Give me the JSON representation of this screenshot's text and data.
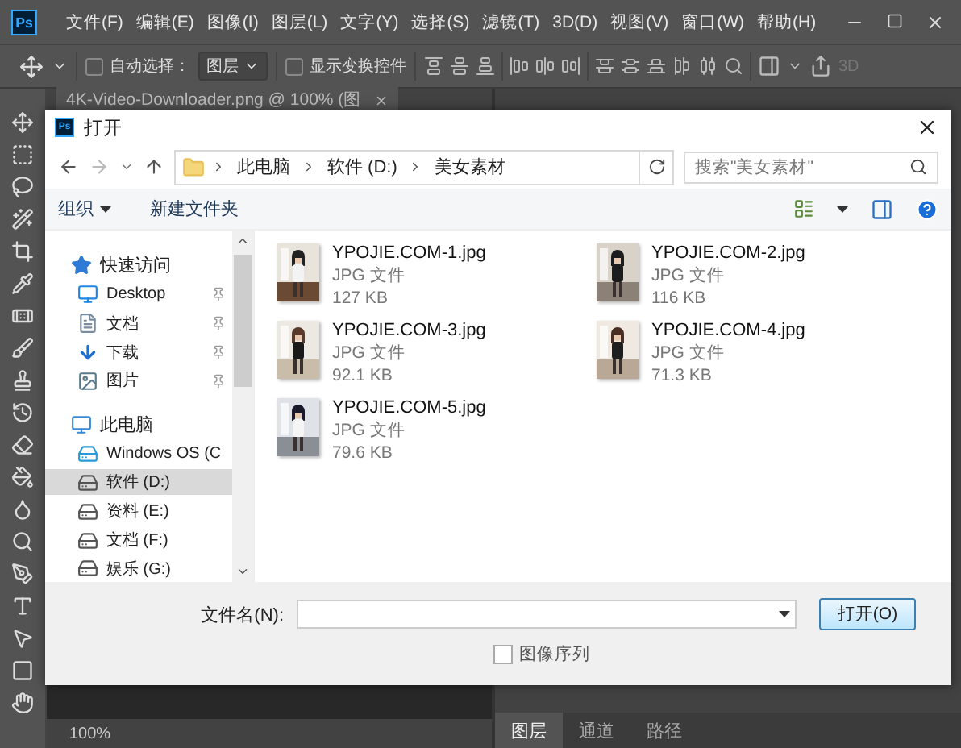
{
  "app": {
    "logo": "Ps",
    "menu": [
      "文件(F)",
      "编辑(E)",
      "图像(I)",
      "图层(L)",
      "文字(Y)",
      "选择(S)",
      "滤镜(T)",
      "3D(D)",
      "视图(V)",
      "窗口(W)",
      "帮助(H)"
    ]
  },
  "options_bar": {
    "auto_select": {
      "label": "自动选择：",
      "checked": false
    },
    "layer_select": "图层",
    "show_transform": {
      "label": "显示变换控件",
      "checked": false
    },
    "mode_3d": "3D"
  },
  "document_tab": {
    "title": "4K-Video-Downloader.png @ 100% (图"
  },
  "dialog": {
    "logo": "Ps",
    "title": "打开",
    "breadcrumb": [
      "此电脑",
      "软件 (D:)",
      "美女素材"
    ],
    "search": {
      "placeholder": "搜索\"美女素材\""
    },
    "commands": [
      "组织",
      "新建文件夹"
    ],
    "sidebar": [
      {
        "label": "快速访问",
        "kind": "quick-access",
        "selected": false,
        "children": [
          {
            "label": "Desktop",
            "kind": "desktop",
            "pinned": true,
            "selected": false
          },
          {
            "label": "文档",
            "kind": "documents",
            "pinned": true,
            "selected": false
          },
          {
            "label": "下载",
            "kind": "downloads",
            "pinned": true,
            "selected": false
          },
          {
            "label": "图片",
            "kind": "pictures",
            "pinned": true,
            "selected": false
          }
        ]
      },
      {
        "label": "此电脑",
        "kind": "computer",
        "selected": false,
        "children": [
          {
            "label": "Windows OS (C",
            "kind": "system-drive",
            "selected": false
          },
          {
            "label": "软件 (D:)",
            "kind": "drive",
            "selected": true
          },
          {
            "label": "资料 (E:)",
            "kind": "drive",
            "selected": false
          },
          {
            "label": "文档 (F:)",
            "kind": "drive",
            "selected": false
          },
          {
            "label": "娱乐 (G:)",
            "kind": "drive",
            "selected": false
          }
        ]
      }
    ],
    "files": [
      {
        "name": "YPOJIE.COM-1.jpg",
        "type": "JPG 文件",
        "size": "127 KB"
      },
      {
        "name": "YPOJIE.COM-2.jpg",
        "type": "JPG 文件",
        "size": "116 KB"
      },
      {
        "name": "YPOJIE.COM-3.jpg",
        "type": "JPG 文件",
        "size": "92.1 KB"
      },
      {
        "name": "YPOJIE.COM-4.jpg",
        "type": "JPG 文件",
        "size": "71.3 KB"
      },
      {
        "name": "YPOJIE.COM-5.jpg",
        "type": "JPG 文件",
        "size": "79.6 KB"
      }
    ],
    "filename_label": "文件名(N):",
    "open_button": "打开(O)",
    "image_sequence": {
      "label": "图像序列",
      "checked": false
    }
  },
  "status_bar": {
    "zoom": "100%"
  },
  "panel_tabs": [
    {
      "label": "图层",
      "selected": true
    },
    {
      "label": "通道",
      "selected": false
    },
    {
      "label": "路径",
      "selected": false
    }
  ]
}
